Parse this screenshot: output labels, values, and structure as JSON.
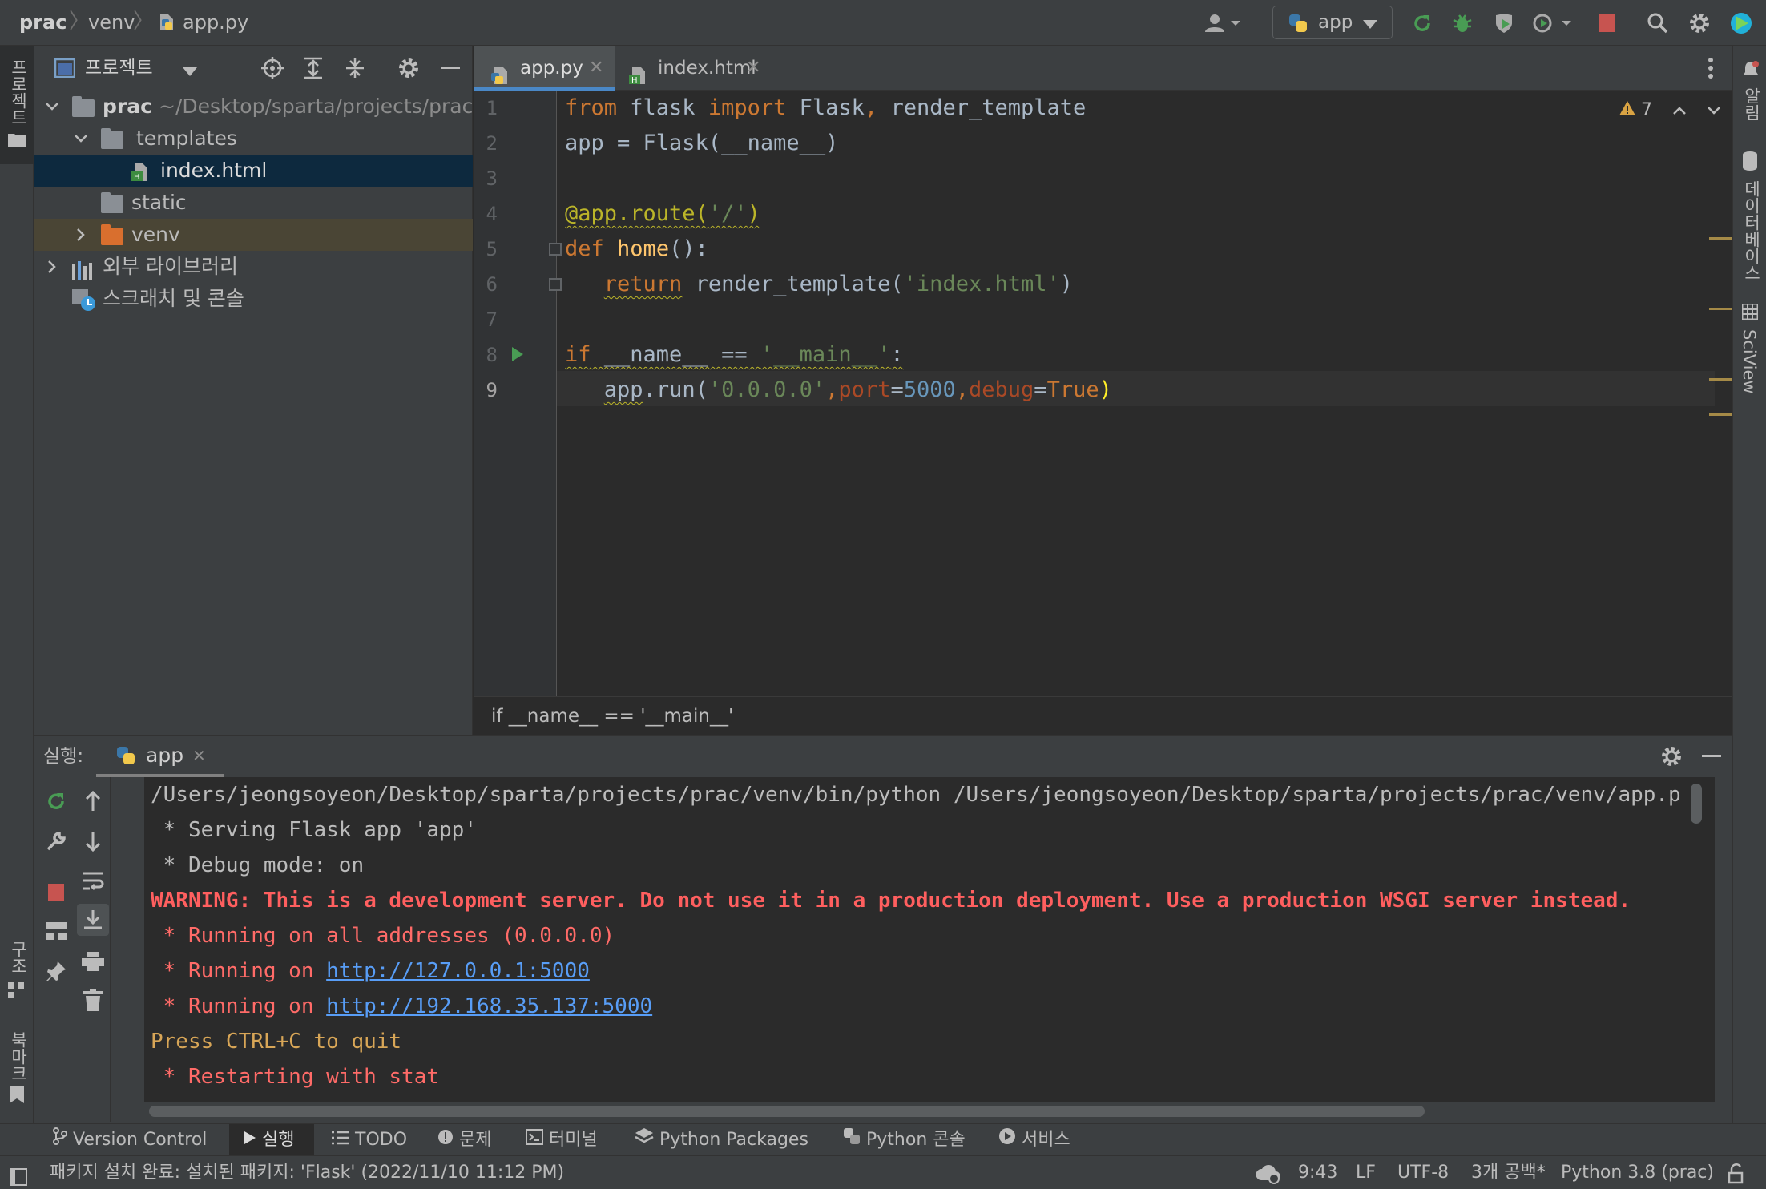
{
  "titlebar": {
    "crumbs": [
      "prac",
      "venv",
      "app.py"
    ],
    "run_config": "app"
  },
  "left_strip": {
    "project_label": "프로젝트",
    "structure_label": "구조",
    "bookmarks_label": "북마크"
  },
  "right_strip": {
    "notifications_label": "알림",
    "database_label": "데이터베이스",
    "sciview_label": "SciView"
  },
  "project": {
    "header_label": "프로젝트",
    "tree": [
      {
        "name": "prac",
        "path": "~/Desktop/sparta/projects/prac"
      },
      {
        "name": "templates"
      },
      {
        "name": "index.html"
      },
      {
        "name": "static"
      },
      {
        "name": "venv"
      },
      {
        "name": "외부 라이브러리"
      },
      {
        "name": "스크래치 및 콘솔"
      }
    ]
  },
  "editor": {
    "tabs": [
      {
        "label": "app.py"
      },
      {
        "label": "index.html"
      }
    ],
    "warnings_count": "7",
    "line_numbers": [
      "1",
      "2",
      "3",
      "4",
      "5",
      "6",
      "7",
      "8",
      "9"
    ],
    "breadcrumb": "if __name__ == '__main__'"
  },
  "run": {
    "label": "실행:",
    "tab": "app",
    "console": [
      "/Users/jeongsoyeon/Desktop/sparta/projects/prac/venv/bin/python /Users/jeongsoyeon/Desktop/sparta/projects/prac/venv/app.p",
      " * Serving Flask app 'app'",
      " * Debug mode: on",
      "WARNING: This is a development server. Do not use it in a production deployment. Use a production WSGI server instead.",
      " * Running on all addresses (0.0.0.0)",
      " * Running on ",
      "http://127.0.0.1:5000",
      " * Running on ",
      "http://192.168.35.137:5000",
      "Press CTRL+C to quit",
      " * Restarting with stat"
    ]
  },
  "bottom_tabs": [
    "Version Control",
    "실행",
    "TODO",
    "문제",
    "터미널",
    "Python Packages",
    "Python 콘솔",
    "서비스"
  ],
  "status": {
    "message": "패키지 설치 완료: 설치된 패키지: 'Flask' (2022/11/10 11:12 PM)",
    "position": "9:43",
    "line_sep": "LF",
    "encoding": "UTF-8",
    "indent": "3개 공백*",
    "interpreter": "Python 3.8 (prac)"
  },
  "colors": {
    "accent": "#589df6",
    "run_green": "#499c54",
    "stop_red": "#c75450",
    "selection": "#0d293e"
  }
}
